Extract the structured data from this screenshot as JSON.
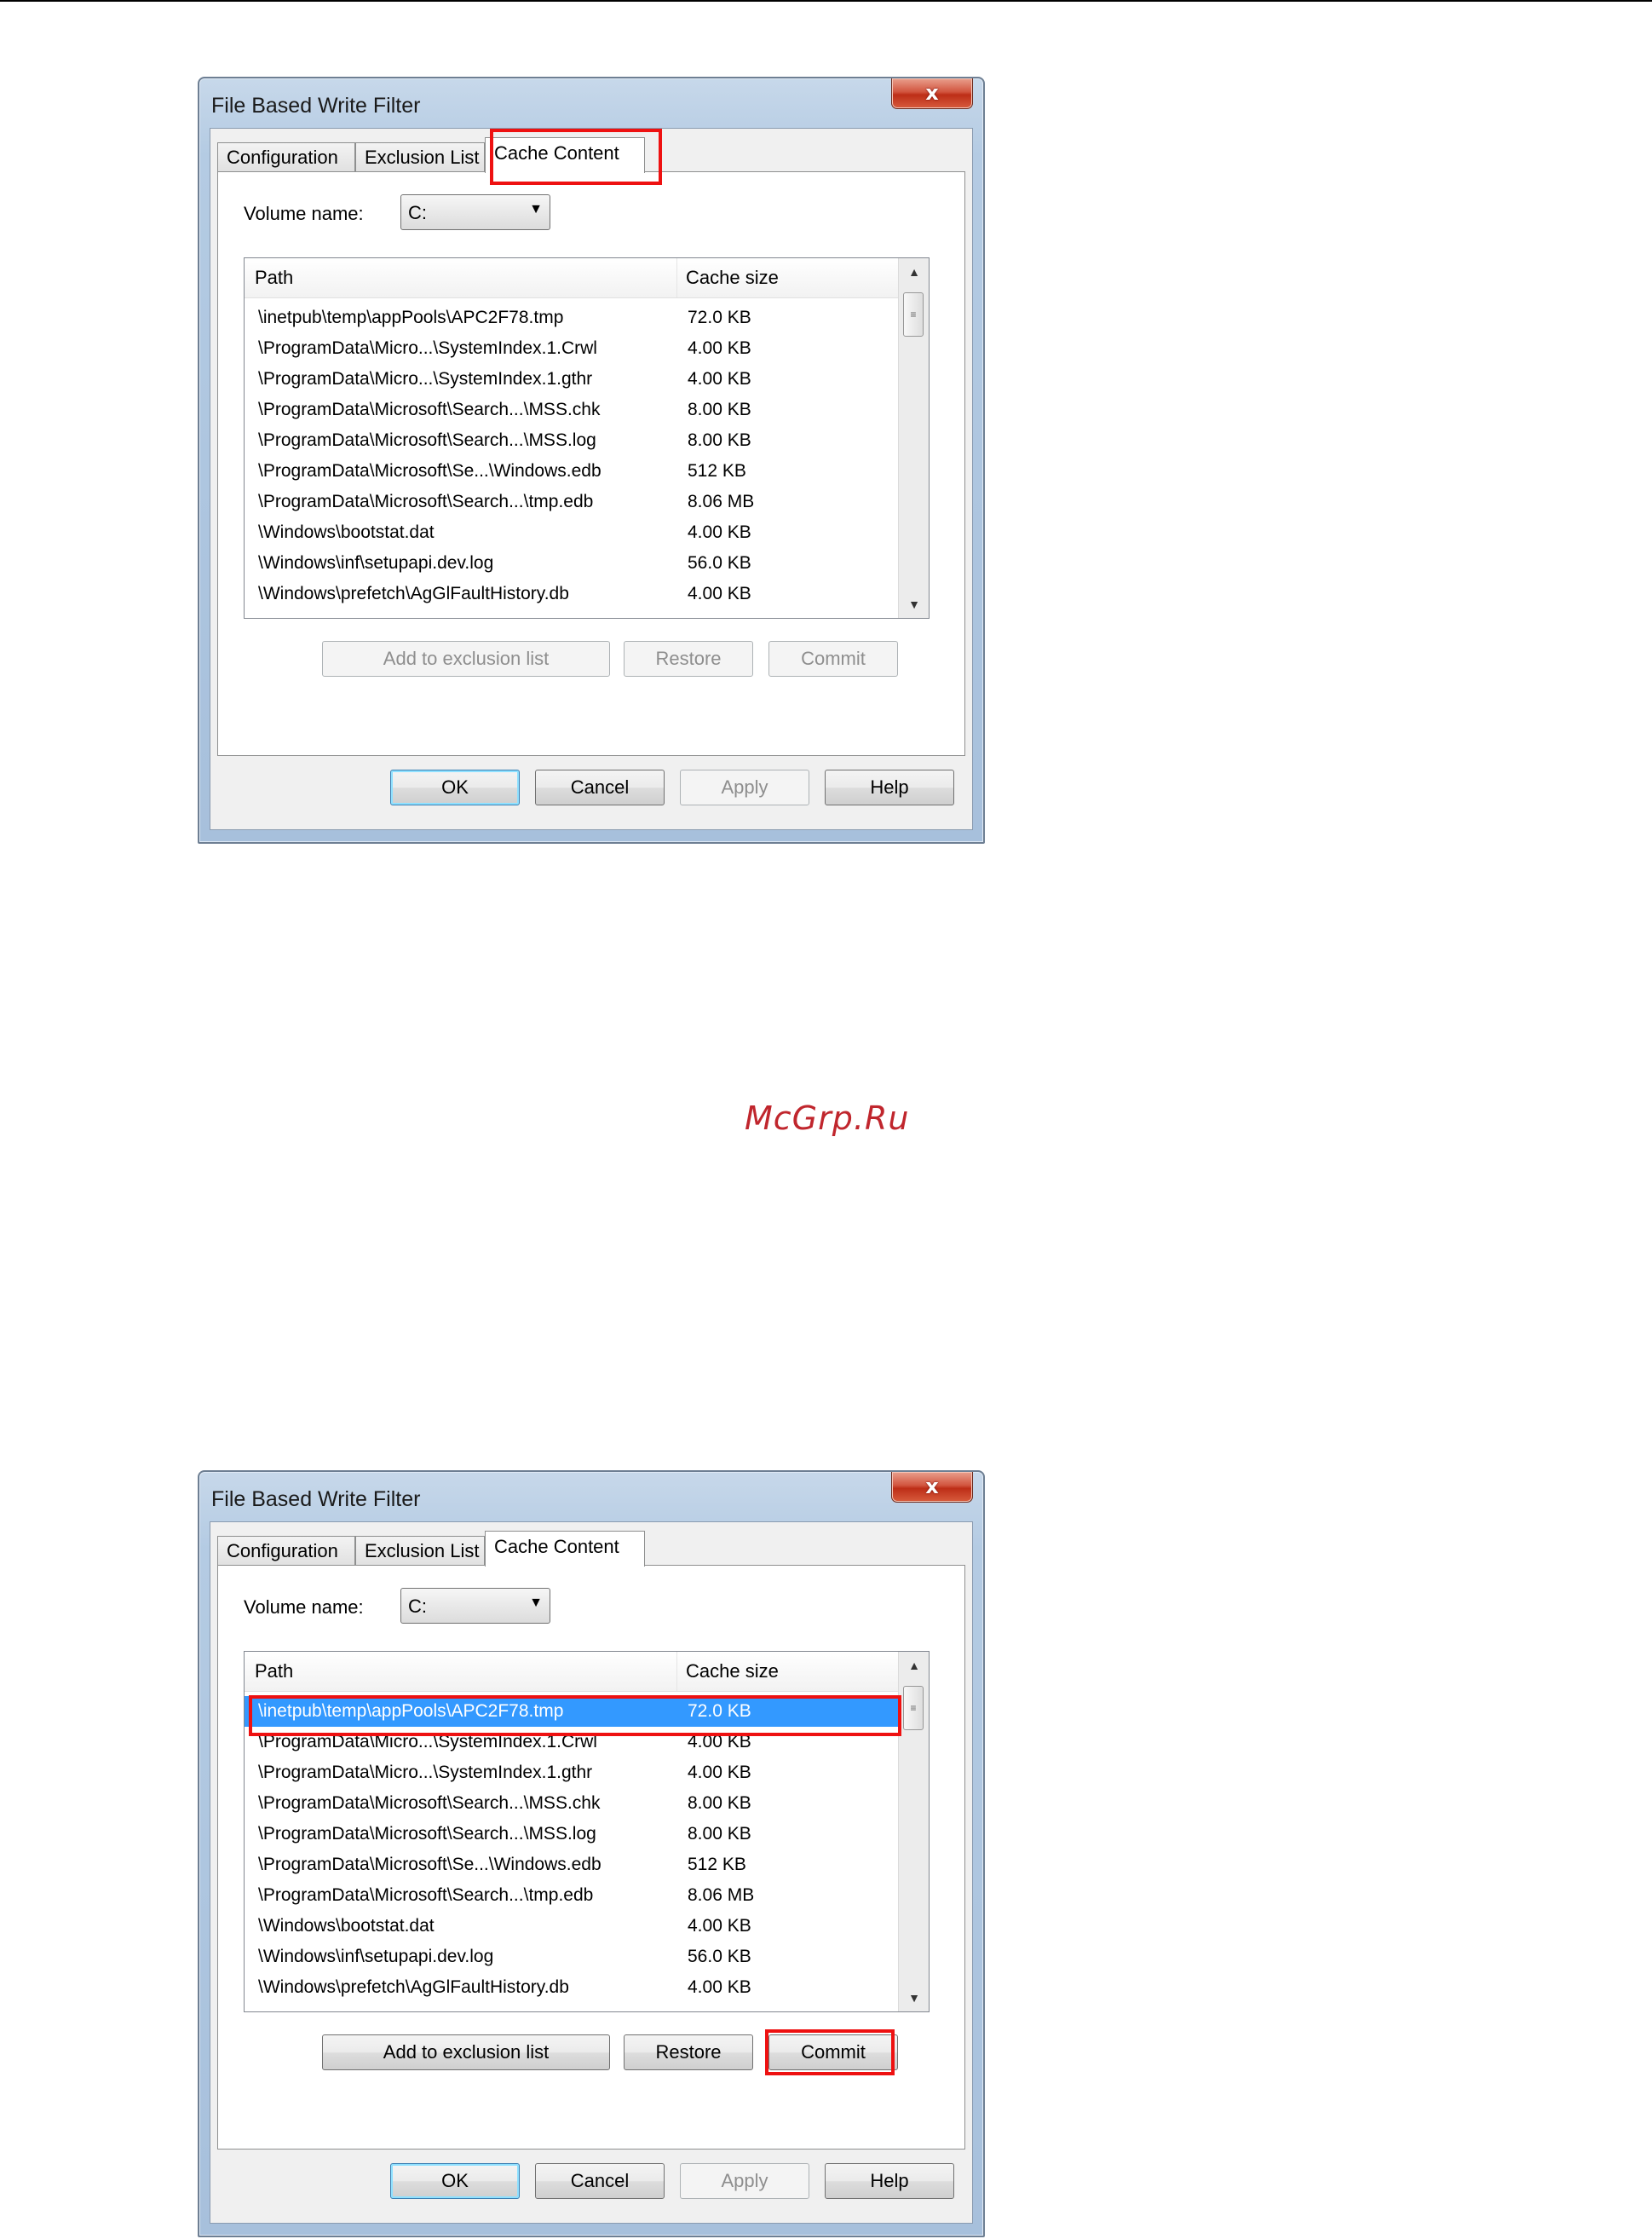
{
  "watermark": "McGrp.Ru",
  "dialogs": [
    {
      "title": "File Based Write Filter",
      "close_label": "x",
      "tabs": [
        "Configuration",
        "Exclusion List",
        "Cache Content"
      ],
      "active_tab": "Cache Content",
      "volume": {
        "label": "Volume name:",
        "value": "C:",
        "arrow": "▼"
      },
      "list": {
        "columns": [
          "Path",
          "Cache size"
        ],
        "rows": [
          {
            "path": "\\inetpub\\temp\\appPools\\APC2F78.tmp",
            "size": "72.0 KB"
          },
          {
            "path": "\\ProgramData\\Micro...\\SystemIndex.1.Crwl",
            "size": "4.00 KB"
          },
          {
            "path": "\\ProgramData\\Micro...\\SystemIndex.1.gthr",
            "size": "4.00 KB"
          },
          {
            "path": "\\ProgramData\\Microsoft\\Search...\\MSS.chk",
            "size": "8.00 KB"
          },
          {
            "path": "\\ProgramData\\Microsoft\\Search...\\MSS.log",
            "size": "8.00 KB"
          },
          {
            "path": "\\ProgramData\\Microsoft\\Se...\\Windows.edb",
            "size": "512 KB"
          },
          {
            "path": "\\ProgramData\\Microsoft\\Search...\\tmp.edb",
            "size": "8.06 MB"
          },
          {
            "path": "\\Windows\\bootstat.dat",
            "size": "4.00 KB"
          },
          {
            "path": "\\Windows\\inf\\setupapi.dev.log",
            "size": "56.0 KB"
          },
          {
            "path": "\\Windows\\prefetch\\AgGlFaultHistory.db",
            "size": "4.00 KB"
          }
        ],
        "selected_index": null
      },
      "buttons": {
        "add": "Add to exclusion list",
        "restore": "Restore",
        "commit": "Commit",
        "ok": "OK",
        "cancel": "Cancel",
        "apply": "Apply",
        "help": "Help"
      },
      "enabled": {
        "add": false,
        "restore": false,
        "commit": false,
        "apply": false
      }
    },
    {
      "title": "File Based Write Filter",
      "close_label": "x",
      "tabs": [
        "Configuration",
        "Exclusion List",
        "Cache Content"
      ],
      "active_tab": "Cache Content",
      "volume": {
        "label": "Volume name:",
        "value": "C:",
        "arrow": "▼"
      },
      "list": {
        "columns": [
          "Path",
          "Cache size"
        ],
        "rows": [
          {
            "path": "\\inetpub\\temp\\appPools\\APC2F78.tmp",
            "size": "72.0 KB"
          },
          {
            "path": "\\ProgramData\\Micro...\\SystemIndex.1.Crwl",
            "size": "4.00 KB"
          },
          {
            "path": "\\ProgramData\\Micro...\\SystemIndex.1.gthr",
            "size": "4.00 KB"
          },
          {
            "path": "\\ProgramData\\Microsoft\\Search...\\MSS.chk",
            "size": "8.00 KB"
          },
          {
            "path": "\\ProgramData\\Microsoft\\Search...\\MSS.log",
            "size": "8.00 KB"
          },
          {
            "path": "\\ProgramData\\Microsoft\\Se...\\Windows.edb",
            "size": "512 KB"
          },
          {
            "path": "\\ProgramData\\Microsoft\\Search...\\tmp.edb",
            "size": "8.06 MB"
          },
          {
            "path": "\\Windows\\bootstat.dat",
            "size": "4.00 KB"
          },
          {
            "path": "\\Windows\\inf\\setupapi.dev.log",
            "size": "56.0 KB"
          },
          {
            "path": "\\Windows\\prefetch\\AgGlFaultHistory.db",
            "size": "4.00 KB"
          }
        ],
        "selected_index": 0
      },
      "buttons": {
        "add": "Add to exclusion list",
        "restore": "Restore",
        "commit": "Commit",
        "ok": "OK",
        "cancel": "Cancel",
        "apply": "Apply",
        "help": "Help"
      },
      "enabled": {
        "add": true,
        "restore": true,
        "commit": true,
        "apply": false
      }
    }
  ],
  "colors": {
    "highlight": "#e11111",
    "selection": "#3399ff",
    "watermark": "#c0262d"
  }
}
